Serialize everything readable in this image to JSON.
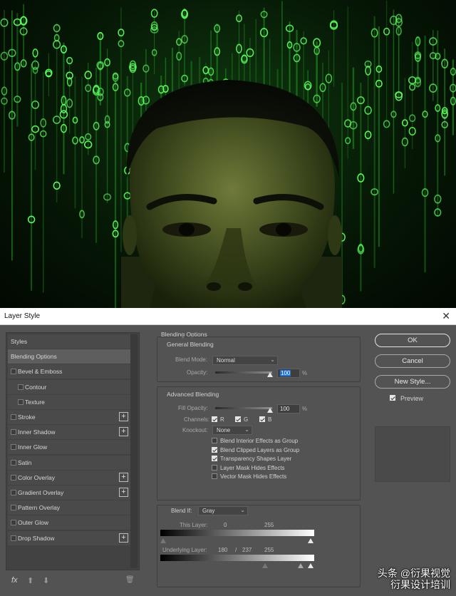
{
  "dialog": {
    "title": "Layer Style"
  },
  "styles_list": {
    "items": [
      {
        "label": "Styles",
        "checkbox": false,
        "plus": false,
        "sub": false,
        "selected": false
      },
      {
        "label": "Blending Options",
        "checkbox": false,
        "plus": false,
        "sub": false,
        "selected": true
      },
      {
        "label": "Bevel & Emboss",
        "checkbox": true,
        "plus": false,
        "sub": false,
        "selected": false
      },
      {
        "label": "Contour",
        "checkbox": true,
        "plus": false,
        "sub": true,
        "selected": false
      },
      {
        "label": "Texture",
        "checkbox": true,
        "plus": false,
        "sub": true,
        "selected": false
      },
      {
        "label": "Stroke",
        "checkbox": true,
        "plus": true,
        "sub": false,
        "selected": false
      },
      {
        "label": "Inner Shadow",
        "checkbox": true,
        "plus": true,
        "sub": false,
        "selected": false
      },
      {
        "label": "Inner Glow",
        "checkbox": true,
        "plus": false,
        "sub": false,
        "selected": false
      },
      {
        "label": "Satin",
        "checkbox": true,
        "plus": false,
        "sub": false,
        "selected": false
      },
      {
        "label": "Color Overlay",
        "checkbox": true,
        "plus": true,
        "sub": false,
        "selected": false
      },
      {
        "label": "Gradient Overlay",
        "checkbox": true,
        "plus": true,
        "sub": false,
        "selected": false
      },
      {
        "label": "Pattern Overlay",
        "checkbox": true,
        "plus": false,
        "sub": false,
        "selected": false
      },
      {
        "label": "Outer Glow",
        "checkbox": true,
        "plus": false,
        "sub": false,
        "selected": false
      },
      {
        "label": "Drop Shadow",
        "checkbox": true,
        "plus": true,
        "sub": false,
        "selected": false
      }
    ],
    "footer": {
      "fx": "fx",
      "up": "⬆",
      "down": "⬇",
      "trash": "🗑"
    }
  },
  "blending": {
    "header": "Blending Options",
    "general": {
      "header": "General Blending",
      "blend_mode_label": "Blend Mode:",
      "blend_mode": "Normal",
      "opacity_label": "Opacity:",
      "opacity": "100",
      "unit": "%"
    },
    "advanced": {
      "header": "Advanced Blending",
      "fill_opacity_label": "Fill Opacity:",
      "fill_opacity": "100",
      "unit": "%",
      "channels_label": "Channels:",
      "channel_r": "R",
      "channel_g": "G",
      "channel_b": "B",
      "knockout_label": "Knockout:",
      "knockout": "None",
      "options": [
        {
          "label": "Blend Interior Effects as Group",
          "checked": false
        },
        {
          "label": "Blend Clipped Layers as Group",
          "checked": true
        },
        {
          "label": "Transparency Shapes Layer",
          "checked": true
        },
        {
          "label": "Layer Mask Hides Effects",
          "checked": false
        },
        {
          "label": "Vector Mask Hides Effects",
          "checked": false
        }
      ]
    },
    "blend_if": {
      "label": "Blend If:",
      "value": "Gray",
      "this_layer_label": "This Layer:",
      "this_layer_low": "0",
      "this_layer_high": "255",
      "underlying_label": "Underlying Layer:",
      "underlying_low": "180",
      "underlying_sep1": "/",
      "underlying_mid": "237",
      "underlying_high": "255"
    }
  },
  "buttons": {
    "ok": "OK",
    "cancel": "Cancel",
    "new_style": "New Style...",
    "preview_label": "Preview"
  },
  "watermark": {
    "line1": "头条 @衍果视觉",
    "line2": "衍果设计培训"
  }
}
